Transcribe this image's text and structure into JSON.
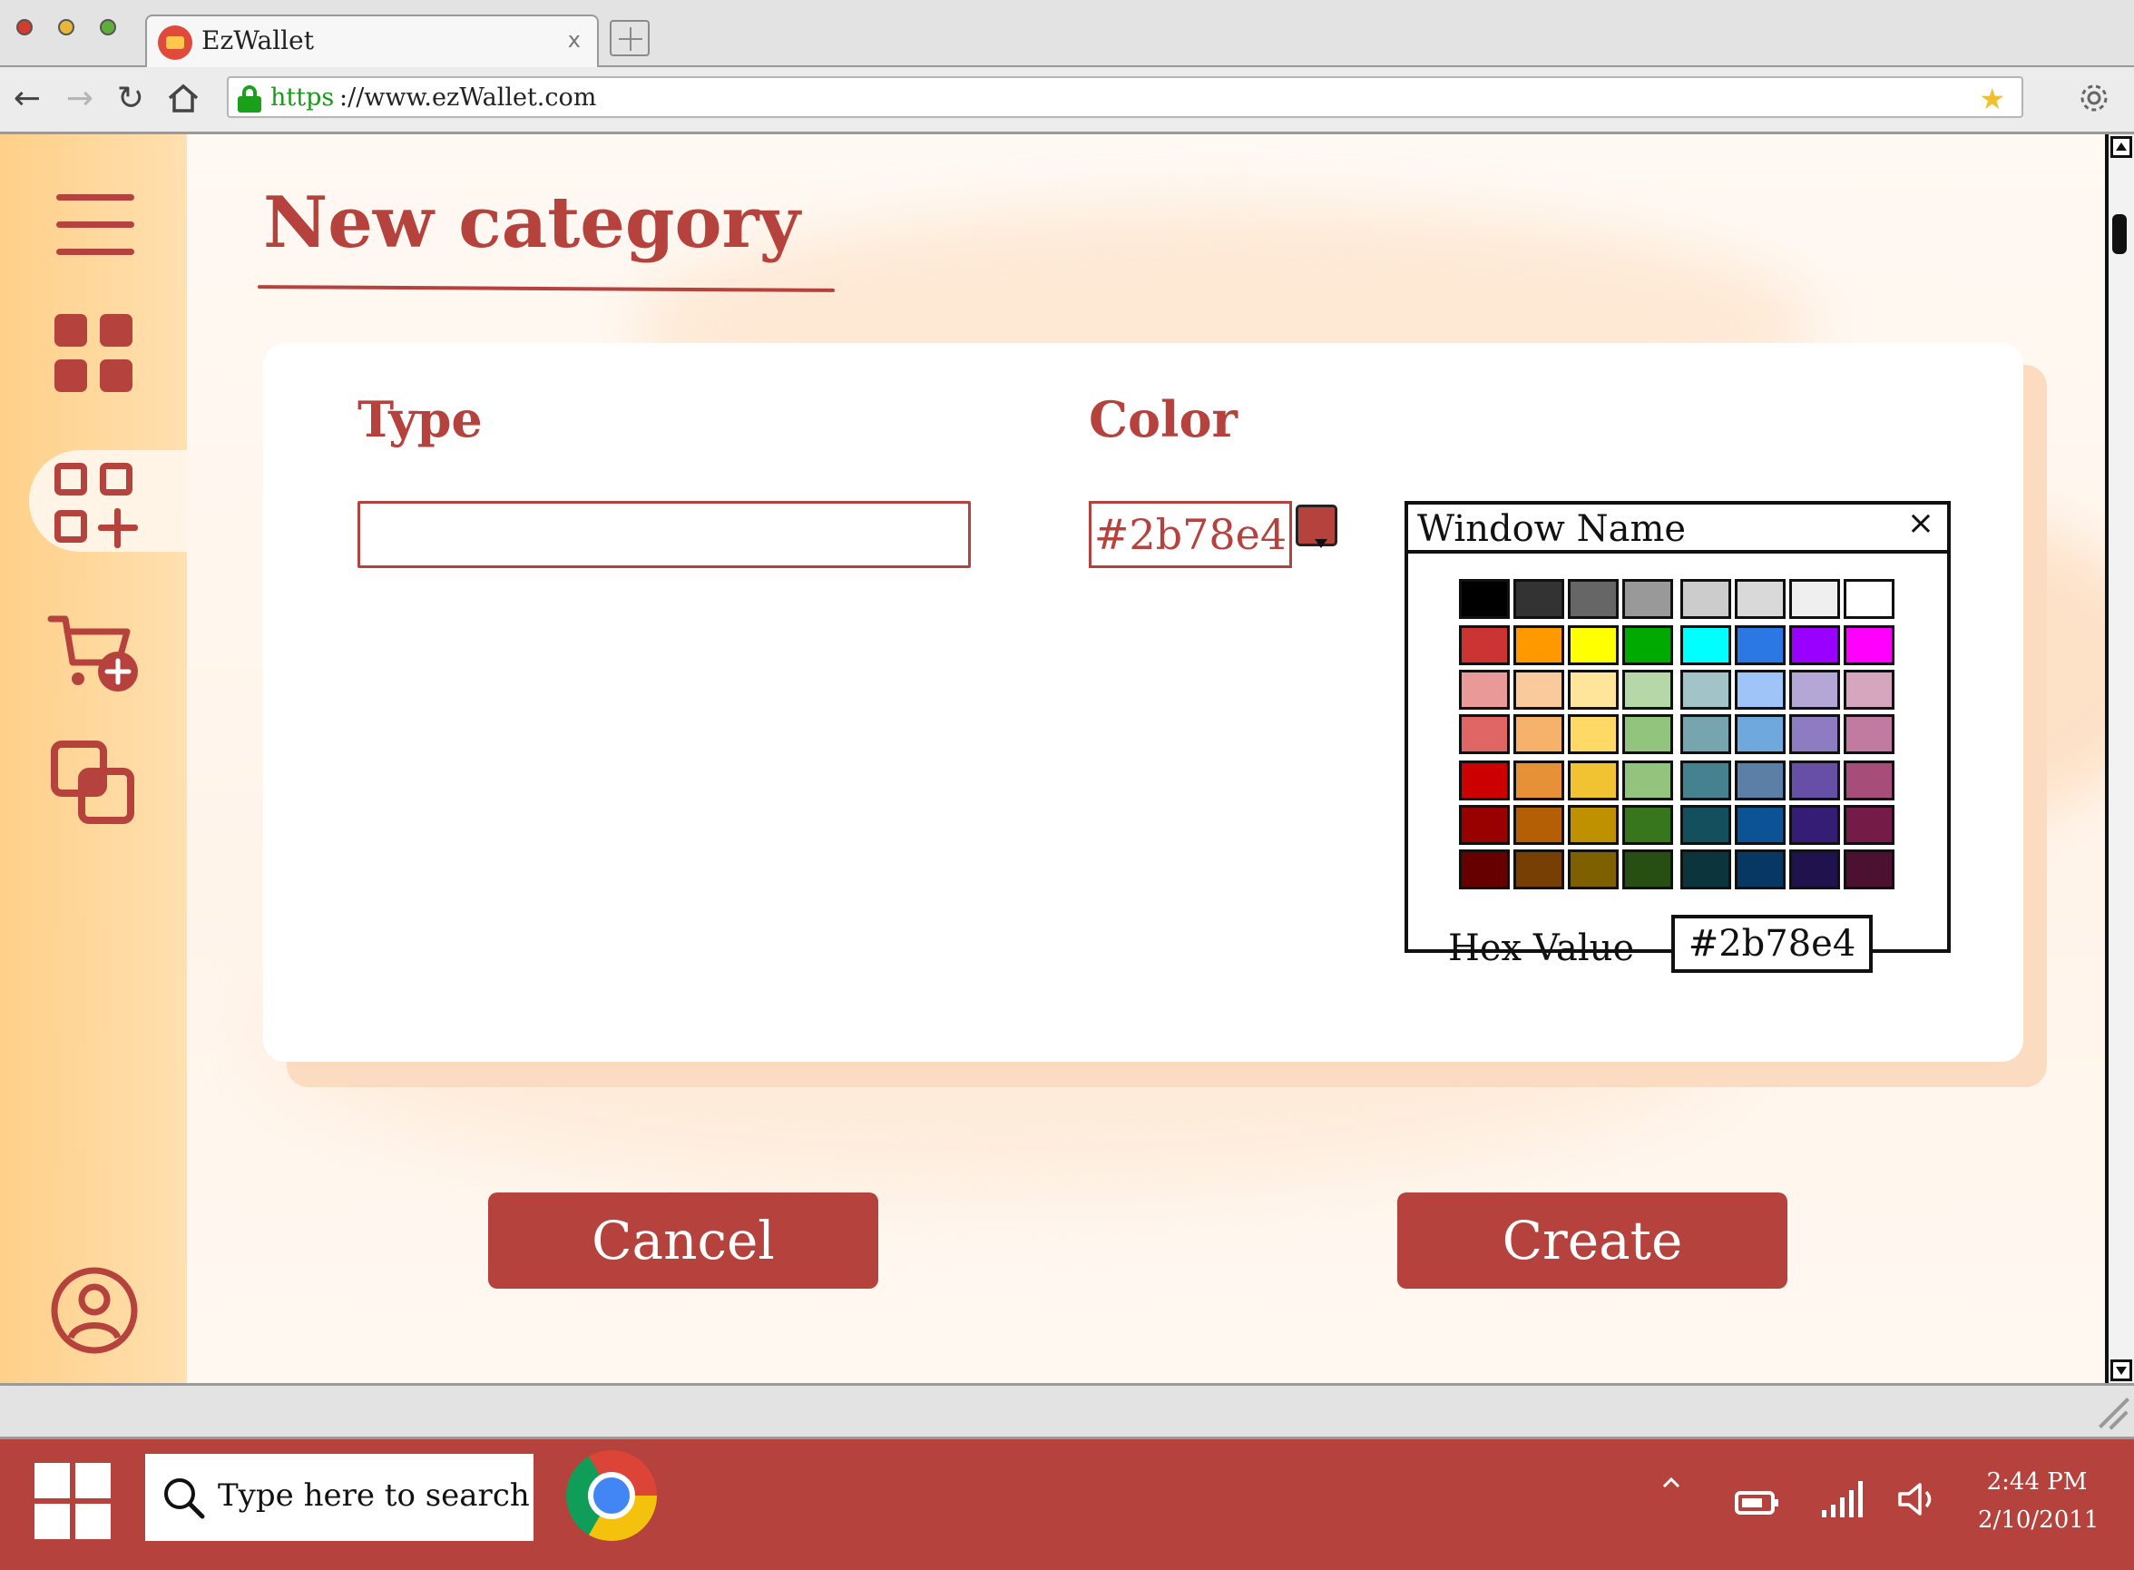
{
  "browser": {
    "tab_title": "EzWallet",
    "tab_close": "x",
    "url_scheme": "https",
    "url_rest": "://www.ezWallet.com"
  },
  "sidebar": {
    "items": [
      {
        "name": "menu",
        "icon": "hamburger-icon"
      },
      {
        "name": "dashboard",
        "icon": "grid-icon"
      },
      {
        "name": "new-category",
        "icon": "grid-plus-icon",
        "active": true
      },
      {
        "name": "add-transaction",
        "icon": "cart-plus-icon"
      },
      {
        "name": "groups",
        "icon": "copy-squares-icon"
      },
      {
        "name": "profile",
        "icon": "user-circle-icon"
      }
    ]
  },
  "page": {
    "title": "New category"
  },
  "form": {
    "type_label": "Type",
    "type_value": "",
    "color_label": "Color",
    "color_value": "#2b78e4"
  },
  "color_picker": {
    "window_name": "Window Name",
    "close": "×",
    "hex_label": "Hex Value",
    "hex_value": "#2b78e4",
    "palette": [
      [
        "#000000",
        "#333333",
        "#666666",
        "#999999",
        "#cccccc",
        "#d9d9d9",
        "#efefef",
        "#ffffff"
      ],
      [
        "#cc3333",
        "#ff9900",
        "#ffff00",
        "#00aa00",
        "#00ffff",
        "#2b78e4",
        "#9900ff",
        "#ff00ff"
      ],
      [
        "#ea9999",
        "#f9cb9c",
        "#ffe599",
        "#b6d7a8",
        "#a2c4c9",
        "#9fc5f8",
        "#b4a7d6",
        "#d5a6bd"
      ],
      [
        "#e06666",
        "#f6b26b",
        "#ffd966",
        "#93c47d",
        "#76a5af",
        "#6fa8dc",
        "#8e7cc3",
        "#c27ba0"
      ],
      [
        "#cc0000",
        "#e69138",
        "#f1c232",
        "#93c47d",
        "#45818e",
        "#5b7fa6",
        "#674ea7",
        "#a64d79"
      ],
      [
        "#990000",
        "#b45f06",
        "#bf9000",
        "#38761d",
        "#134f5c",
        "#0b5394",
        "#351c75",
        "#741b47"
      ],
      [
        "#660000",
        "#783f04",
        "#7f6000",
        "#274e13",
        "#0c343d",
        "#073763",
        "#20124d",
        "#4c1130"
      ]
    ]
  },
  "actions": {
    "cancel": "Cancel",
    "create": "Create"
  },
  "taskbar": {
    "search_placeholder": "Type here to search",
    "time": "2:44 PM",
    "date": "2/10/2011"
  },
  "colors": {
    "accent": "#b5423c",
    "sidebar": "#ffd089"
  }
}
